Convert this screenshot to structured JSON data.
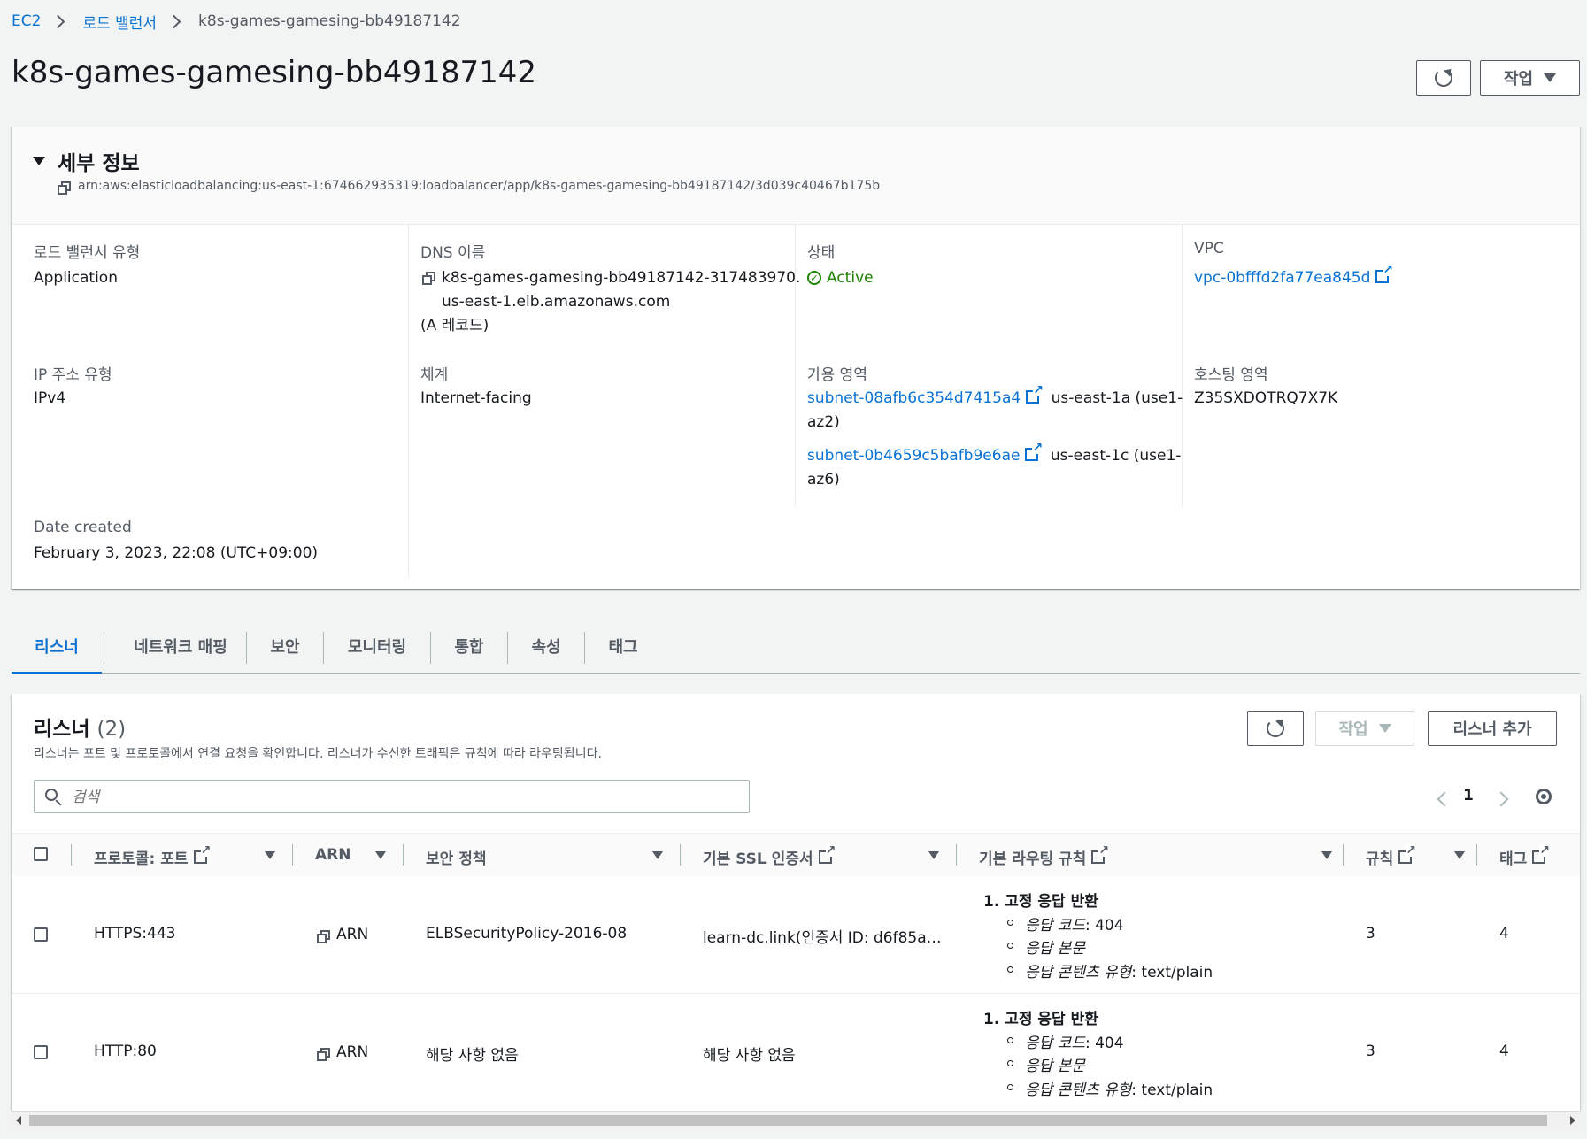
{
  "breadcrumb": {
    "ec2": "EC2",
    "load_balancers": "로드 밸런서",
    "current": "k8s-games-gamesing-bb49187142"
  },
  "page_title": "k8s-games-gamesing-bb49187142",
  "header_actions": {
    "actions_label": "작업"
  },
  "details": {
    "title": "세부 정보",
    "arn": "arn:aws:elasticloadbalancing:us-east-1:674662935319:loadbalancer/app/k8s-games-gamesing-bb49187142/3d039c40467b175b",
    "lb_type_label": "로드 밸런서 유형",
    "lb_type_value": "Application",
    "dns_label": "DNS 이름",
    "dns_line1": "k8s-games-gamesing-bb49187142-317483970.",
    "dns_line2": "us-east-1.elb.amazonaws.com",
    "dns_record": "(A 레코드)",
    "status_label": "상태",
    "status_value": "Active",
    "vpc_label": "VPC",
    "vpc_value": "vpc-0bfffd2fa77ea845d",
    "ip_type_label": "IP 주소 유형",
    "ip_type_value": "IPv4",
    "scheme_label": "체계",
    "scheme_value": "Internet-facing",
    "az_label": "가용 영역",
    "az": [
      {
        "subnet": "subnet-08afb6c354d7415a4",
        "zone": "us-east-1a (use1-",
        "zone2": "az2)"
      },
      {
        "subnet": "subnet-0b4659c5bafb9e6ae",
        "zone": "us-east-1c (use1-",
        "zone2": "az6)"
      }
    ],
    "hosted_zone_label": "호스팅 영역",
    "hosted_zone_value": "Z35SXDOTRQ7X7K",
    "date_created_label": "Date created",
    "date_created_value": "February 3, 2023, 22:08 (UTC+09:00)"
  },
  "tabs": [
    "리스너",
    "네트워크 매핑",
    "보안",
    "모니터링",
    "통합",
    "속성",
    "태그"
  ],
  "listeners": {
    "title": "리스너",
    "count": "(2)",
    "description": "리스너는 포트 및 프로토콜에서 연결 요청을 확인합니다. 리스너가 수신한 트래픽은 규칙에 따라 라우팅됩니다.",
    "actions_label": "작업",
    "add_label": "리스너 추가",
    "search_placeholder": "검색",
    "page": "1",
    "columns": [
      "프로토콜: 포트",
      "ARN",
      "보안 정책",
      "기본 SSL 인증서",
      "기본 라우팅 규칙",
      "규칙",
      "태그"
    ],
    "rows": [
      {
        "protocol": "HTTPS:443",
        "arn": "ARN",
        "policy": "ELBSecurityPolicy-2016-08",
        "cert": "learn-dc.link(인증서 ID: d6f85a…",
        "rule_title": "1. 고정 응답 반환",
        "rule_code_k": "응답 코드",
        "rule_code_v": ": 404",
        "rule_body_k": "응답 본문",
        "rule_ct_k": "응답 콘텐츠 유형",
        "rule_ct_v": ": text/plain",
        "rules": "3",
        "tags": "4"
      },
      {
        "protocol": "HTTP:80",
        "arn": "ARN",
        "policy": "해당 사항 없음",
        "cert": "해당 사항 없음",
        "rule_title": "1. 고정 응답 반환",
        "rule_code_k": "응답 코드",
        "rule_code_v": ": 404",
        "rule_body_k": "응답 본문",
        "rule_ct_k": "응답 콘텐츠 유형",
        "rule_ct_v": ": text/plain",
        "rules": "3",
        "tags": "4"
      }
    ]
  },
  "colors": {
    "link": "#0972d3",
    "success": "#1d8102",
    "text": "#16191f",
    "muted": "#545b64"
  }
}
